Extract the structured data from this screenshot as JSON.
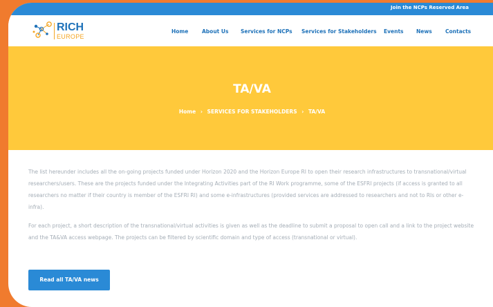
{
  "topbar": {
    "reserved_area_link": "Join the NCPs Reserved Area"
  },
  "logo": {
    "name": "RICH",
    "subtitle": "EUROPE"
  },
  "nav": {
    "items": [
      "Home",
      "About Us",
      "Services for NCPs",
      "Services for Stakeholders",
      "Events",
      "News",
      "Contacts"
    ]
  },
  "hero": {
    "title": "TA/VA",
    "breadcrumb": [
      "Home",
      "SERVICES FOR STAKEHOLDERS",
      "TA/VA"
    ],
    "separator": "›"
  },
  "content": {
    "paragraph_1": "The list hereunder includes all the on-going projects funded under Horizon 2020 and the Horizon Europe RI to open their research infrastructures to transnational/virtual researchers/users. These are the projects funded under the Integrating Activities part of the RI Work programme, some of the ESFRI projects (if access is granted to all researchers no matter if their country is member of the ESFRI RI) and some e-infrastructures (provided services are addressed to researchers and not to RIs or other e-infra).",
    "paragraph_2": "For each project, a short description of the transnational/virtual activities is given as well as the deadline to submit a proposal to open call and a link to the project website and the TA&VA access webpage. The projects can be filtered by scientific domain and type of access (transnational or virtual)."
  },
  "cta": {
    "label": "Read all TA/VA news"
  },
  "colors": {
    "background": "#f07b2e",
    "primary": "#2a8ad6",
    "hero": "#ffc93b",
    "link": "#1f72b9"
  }
}
